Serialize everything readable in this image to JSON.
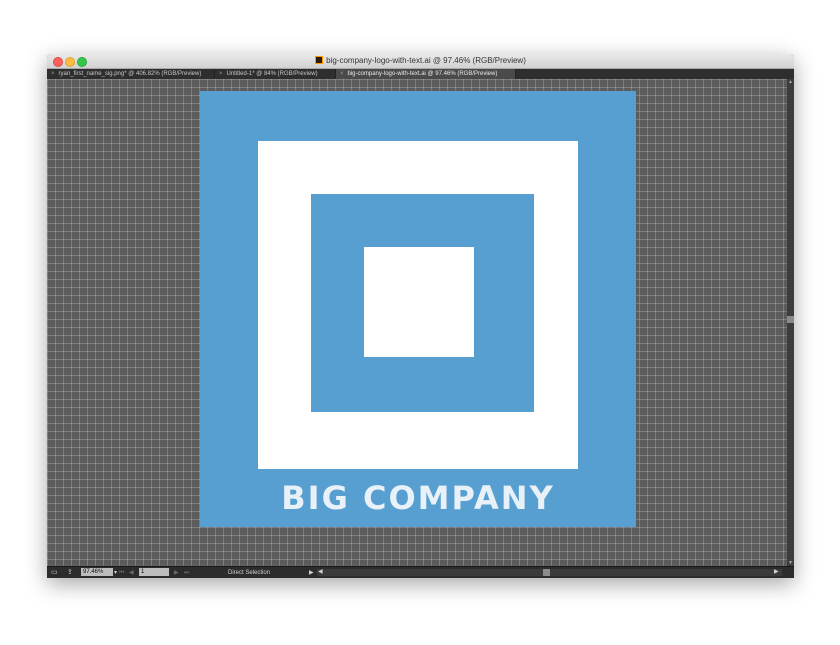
{
  "window": {
    "title": "big-company-logo-with-text.ai @ 97.46% (RGB/Preview)"
  },
  "tabs": [
    {
      "label": "ryan_first_name_sig.png* @ 406.82% (RGB/Preview)",
      "active": false
    },
    {
      "label": "Untitled-1* @ 84% (RGB/Preview)",
      "active": false
    },
    {
      "label": "big-company-logo-with-text.ai @ 97.46% (RGB/Preview)",
      "active": true
    }
  ],
  "tab_close_glyph": "×",
  "artboard": {
    "logo_text": "BIG COMPANY",
    "brand_color": "#579fd0",
    "inner_color": "#ffffff"
  },
  "statusbar": {
    "zoom_value": "97.46%",
    "zoom_arrow": "▾",
    "artboard_number": "1",
    "tool_name": "Direct Selection",
    "first_glyph": "⏮",
    "prev_glyph": "◀",
    "next_glyph": "▶",
    "last_glyph": "⏭",
    "menu_arrow": "▶",
    "scroll_left": "◀",
    "scroll_right": "▶"
  },
  "icons": {
    "doc_icon": "illustrator-file-icon",
    "status_icon": "gpu-preview-icon",
    "share_icon": "share-icon"
  },
  "colors": {
    "canvas_bg": "#5c5c5c",
    "app_chrome": "#2e2e2e"
  }
}
